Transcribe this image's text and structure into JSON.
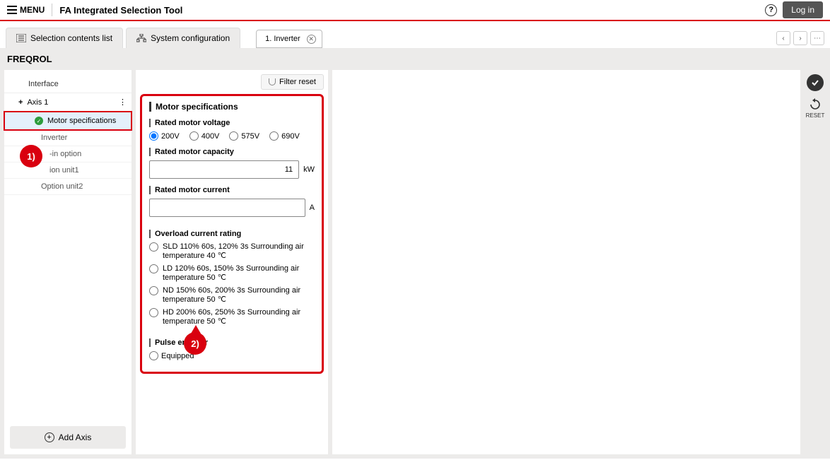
{
  "header": {
    "menu_label": "MENU",
    "app_title": "FA Integrated Selection Tool",
    "login_label": "Log in"
  },
  "tabs": {
    "contents_list": "Selection contents list",
    "system_config": "System configuration",
    "inverter_tab": "1. Inverter"
  },
  "page_title": "FREQROL",
  "tree": {
    "interface": "Interface",
    "axis1": "Axis 1",
    "motor_spec": "Motor specifications",
    "inverter": "Inverter",
    "plugin_option": "-in option",
    "option_unit1": "ion unit1",
    "option_unit2": "Option unit2",
    "add_axis": "Add Axis"
  },
  "filter_reset_label": "Filter reset",
  "form": {
    "section": "Motor specifications",
    "voltage_title": "Rated motor voltage",
    "voltage_opts": {
      "v200": "200V",
      "v400": "400V",
      "v575": "575V",
      "v690": "690V"
    },
    "capacity_title": "Rated motor capacity",
    "capacity_value": "11",
    "capacity_unit": "kW",
    "current_title": "Rated motor current",
    "current_unit": "A",
    "overload_title": "Overload current rating",
    "overload_opts": {
      "sld": "SLD 110% 60s, 120% 3s Surrounding air temperature 40 ℃",
      "ld": "LD 120% 60s, 150% 3s Surrounding air temperature 50 ℃",
      "nd": "ND 150% 60s, 200% 3s Surrounding air temperature 50 ℃",
      "hd": "HD 200% 60s, 250% 3s Surrounding air temperature 50 ℃"
    },
    "pulse_title": "Pulse encoder",
    "pulse_opt": "Equipped"
  },
  "rail": {
    "reset_label": "RESET"
  },
  "annot": {
    "a1": "1)",
    "a2": "2)"
  }
}
